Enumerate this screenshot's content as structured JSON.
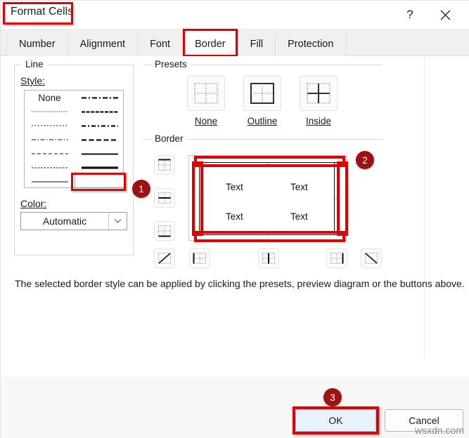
{
  "window": {
    "title": "Format Cells",
    "help_icon": "question-mark-icon",
    "close_icon": "close-icon",
    "help_label": "?",
    "close_label": "✕"
  },
  "tabs": [
    {
      "label": "Number",
      "active": false
    },
    {
      "label": "Alignment",
      "active": false
    },
    {
      "label": "Font",
      "active": false
    },
    {
      "label": "Border",
      "active": true
    },
    {
      "label": "Fill",
      "active": false
    },
    {
      "label": "Protection",
      "active": false
    }
  ],
  "line_group": {
    "legend": "Line",
    "style_label": "Style:",
    "none_label": "None",
    "styles_left": [
      "none",
      "dotted-fine",
      "dotted",
      "dash-dot-long",
      "dash-dot-medium",
      "dashed-fine",
      "solid-thin"
    ],
    "styles_right": [
      "dash-dot-thick",
      "dash-dash-thick",
      "dash-dot-thick2",
      "dashed-thick",
      "solid-medium",
      "solid-thick",
      "double"
    ],
    "selected_style": "double",
    "color_label": "Color:",
    "color_value": "Automatic",
    "color_arrow_icon": "chevron-down-icon"
  },
  "presets": {
    "legend": "Presets",
    "items": [
      {
        "label": "None",
        "underline": "N",
        "icon": "preset-none-icon"
      },
      {
        "label": "Outline",
        "underline": "O",
        "icon": "preset-outline-icon"
      },
      {
        "label": "Inside",
        "underline": "I",
        "icon": "preset-inside-icon"
      }
    ]
  },
  "border_section": {
    "legend": "Border",
    "left_buttons": [
      {
        "name": "border-top-button",
        "icon": "border-top-icon"
      },
      {
        "name": "border-middle-h-button",
        "icon": "border-horizontal-inside-icon"
      },
      {
        "name": "border-bottom-button",
        "icon": "border-bottom-icon"
      }
    ],
    "bottom_buttons": [
      {
        "name": "border-diagonal-up-button",
        "icon": "border-diagonal-up-icon"
      },
      {
        "name": "border-left-button",
        "icon": "border-left-icon"
      },
      {
        "name": "border-middle-v-button",
        "icon": "border-vertical-inside-icon"
      },
      {
        "name": "border-right-button",
        "icon": "border-right-icon"
      },
      {
        "name": "border-diagonal-down-button",
        "icon": "border-diagonal-down-icon"
      }
    ],
    "preview_cells": [
      "Text",
      "Text",
      "Text",
      "Text"
    ],
    "applied_borders": [
      "top",
      "bottom",
      "left",
      "right"
    ]
  },
  "hint": "The selected border style can be applied by clicking the presets, preview diagram or the buttons above.",
  "badges": [
    {
      "number": "1",
      "target": "line-style-double"
    },
    {
      "number": "2",
      "target": "border-preview"
    },
    {
      "number": "3",
      "target": "ok-button"
    }
  ],
  "footer": {
    "ok_label": "OK",
    "cancel_label": "Cancel"
  },
  "watermark": "wsxdn.com",
  "colors": {
    "highlight_red": "#e00000",
    "badge_red": "#9e1214",
    "ok_fill": "#e9f1fa",
    "panel_bg": "#ffffff",
    "dialog_bg": "#f7f7f7"
  }
}
